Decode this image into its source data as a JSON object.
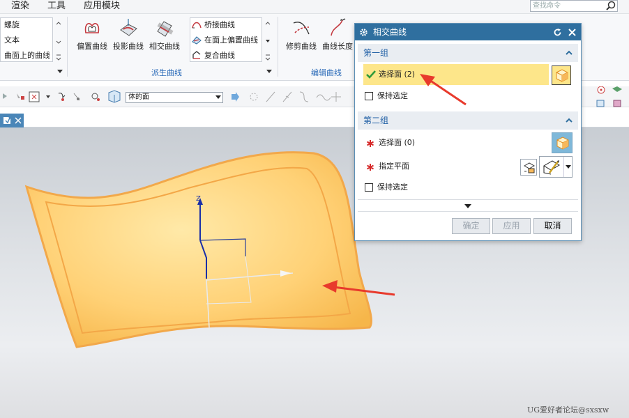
{
  "menubar": {
    "items": [
      "渲染",
      "工具",
      "应用模块"
    ],
    "search_placeholder": "查找命令"
  },
  "ribbon": {
    "left_list": [
      "螺旋",
      "文本",
      "曲面上的曲线"
    ],
    "derived": {
      "buttons": [
        "偏置曲线",
        "投影曲线",
        "相交曲线"
      ],
      "list": [
        "桥接曲线",
        "在面上偏置曲线",
        "复合曲线"
      ],
      "label": "派生曲线"
    },
    "edit": {
      "buttons": [
        "修剪曲线",
        "曲线长度"
      ],
      "label": "编辑曲线"
    }
  },
  "toolbar": {
    "filter_value": "体的面"
  },
  "dialog": {
    "title": "相交曲线",
    "group1": {
      "title": "第一组",
      "select_label": "选择面 (2)",
      "keep_label": "保持选定"
    },
    "group2": {
      "title": "第二组",
      "select_label": "选择面 (0)",
      "plane_label": "指定平面",
      "keep_label": "保持选定"
    },
    "buttons": {
      "ok": "确定",
      "apply": "应用",
      "cancel": "取消"
    }
  },
  "viewport": {
    "axis_label": "Z",
    "surface_color": "#ffc65c",
    "arrow_color": "#e83a2c"
  },
  "watermark": "UG爱好者论坛@sxsxw"
}
